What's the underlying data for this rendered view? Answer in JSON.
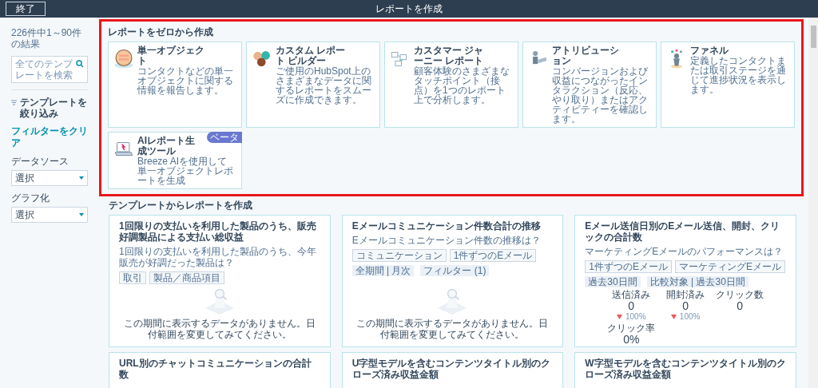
{
  "top_bar": {
    "exit_button": "終了",
    "title": "レポートを作成"
  },
  "sidebar": {
    "result_count": "226件中1～90件の結果",
    "search": {
      "placeholder": "全てのテンプレートを検索"
    },
    "filter_heading": "テンプレートを絞り込み",
    "clear_filters": "フィルターをクリア",
    "selects": [
      {
        "label": "データソース",
        "value": "選択"
      },
      {
        "label": "グラフ化",
        "value": "選択"
      }
    ]
  },
  "scratch_section": {
    "title": "レポートをゼロから作成",
    "highlighted": true,
    "cards": [
      {
        "title": "単一オブジェクト",
        "description": "コンタクトなどの単一オブジェクトに関する情報を報告します。"
      },
      {
        "title": "カスタム レポート ビルダー",
        "description": "ご使用のHubSpot上のさまざまなデータに関するレポートをスムーズに作成できます。"
      },
      {
        "title": "カスタマー ジャーニー レポート",
        "description": "顧客体験のさまざまなタッチポイント（接点）を1つのレポート上で分析します。"
      },
      {
        "title": "アトリビューション",
        "description": "コンバージョンおよび収益につながったインタラクション（反応、やり取り）またはアクティビティーを確認します。"
      },
      {
        "title": "ファネル",
        "description": "定義したコンタクトまたは取引ステージを通じて進捗状況を表示します。"
      },
      {
        "title": "AIレポート生成ツール",
        "description": "Breeze AIを使用して単一オブジェクトレポートを生成",
        "badge": "ベータ"
      }
    ]
  },
  "template_section": {
    "title": "テンプレートからレポートを作成",
    "cards": [
      {
        "kind": "empty",
        "title": "1回限りの支払いを利用した製品のうち、販売好調製品による支払い総収益",
        "question": "1回限りの支払いを利用した製品のうち、今年販売が好調だった製品は？",
        "tags": [
          "取引",
          "製品／商品項目"
        ],
        "empty_message": "この期間に表示するデータがありません。日付範囲を変更してみてください。"
      },
      {
        "kind": "empty",
        "title": "Eメールコミュニケーション件数合計の推移",
        "question": "Eメールコミュニケーション件数の推移は？",
        "tags": [
          "コミュニケーション",
          "1件ずつのEメール"
        ],
        "filters": [
          "全期間 | 月次",
          "フィルター (1)"
        ],
        "empty_message": "この期間に表示するデータがありません。日付範囲を変更してみてください。"
      },
      {
        "kind": "stats",
        "title": "Eメール送信日別のEメール送信、開封、クリックの合計数",
        "question": "マーケティングEメールのパフォーマンスは？",
        "tags": [
          "1件ずつのEメール",
          "マーケティングEメール"
        ],
        "filters": [
          "過去30日間",
          "比較対象 | 過去30日間"
        ],
        "stats": [
          {
            "label": "送信済み",
            "value": "0",
            "change": "100%"
          },
          {
            "label": "開封済み",
            "value": "0",
            "change": "100%"
          },
          {
            "label": "クリック数",
            "value": "0"
          },
          {
            "label": "クリック率",
            "value": "0%"
          }
        ]
      },
      {
        "kind": "title_only",
        "title": "URL別のチャットコミュニケーションの合計数"
      },
      {
        "kind": "title_only",
        "title": "U字型モデルを含むコンテンツタイトル別のクローズ済み収益金額"
      },
      {
        "kind": "title_only",
        "title": "W字型モデルを含むコンテンツタイトル別のクローズ済み収益金額"
      }
    ]
  }
}
